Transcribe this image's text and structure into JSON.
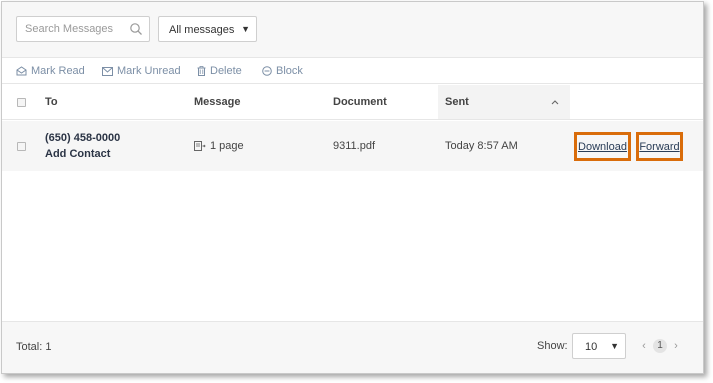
{
  "toolbar": {
    "search_placeholder": "Search Messages",
    "filter_selected": "All messages"
  },
  "actions": {
    "mark_read": "Mark Read",
    "mark_unread": "Mark Unread",
    "delete": "Delete",
    "block": "Block"
  },
  "table": {
    "headers": {
      "to": "To",
      "message": "Message",
      "document": "Document",
      "sent": "Sent"
    },
    "rows": [
      {
        "to_number": "(650) 458-0000",
        "add_contact": "Add Contact",
        "message": "1 page",
        "document": "9311.pdf",
        "sent": "Today 8:57 AM",
        "download": "Download",
        "forward": "Forward"
      }
    ]
  },
  "footer": {
    "total": "Total: 1",
    "show_label": "Show:",
    "show_value": "10",
    "current_page": "1",
    "prev": "‹",
    "next": "›"
  },
  "colors": {
    "highlight_border": "#d96c0a",
    "action_text": "#7c8fa6",
    "link_text": "#2a3d57"
  }
}
